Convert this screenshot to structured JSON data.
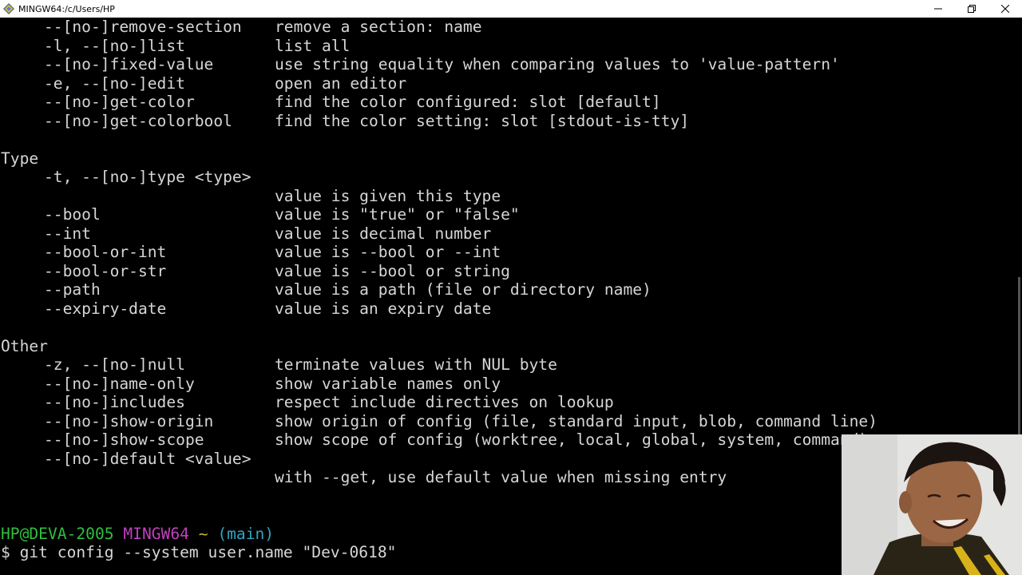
{
  "window": {
    "title": "MINGW64:/c/Users/HP",
    "icon": "git-bash-icon",
    "controls": [
      "minimize-icon",
      "maximize-icon",
      "close-icon"
    ]
  },
  "terminal": {
    "top_lines": [
      {
        "opt": "--[no-]remove-section",
        "desc": "remove a section: name"
      },
      {
        "opt": "-l, --[no-]list",
        "desc": "list all"
      },
      {
        "opt": "--[no-]fixed-value",
        "desc": "use string equality when comparing values to 'value-pattern'"
      },
      {
        "opt": "-e, --[no-]edit",
        "desc": "open an editor"
      },
      {
        "opt": "--[no-]get-color",
        "desc": "find the color configured: slot [default]"
      },
      {
        "opt": "--[no-]get-colorbool",
        "desc": "find the color setting: slot [stdout-is-tty]"
      }
    ],
    "type_section": {
      "heading": "Type",
      "lines": [
        {
          "opt": "-t, --[no-]type <type>",
          "desc": ""
        },
        {
          "opt": "",
          "desc": "value is given this type"
        },
        {
          "opt": "--bool",
          "desc": "value is \"true\" or \"false\""
        },
        {
          "opt": "--int",
          "desc": "value is decimal number"
        },
        {
          "opt": "--bool-or-int",
          "desc": "value is --bool or --int"
        },
        {
          "opt": "--bool-or-str",
          "desc": "value is --bool or string"
        },
        {
          "opt": "--path",
          "desc": "value is a path (file or directory name)"
        },
        {
          "opt": "--expiry-date",
          "desc": "value is an expiry date"
        }
      ]
    },
    "other_section": {
      "heading": "Other",
      "lines": [
        {
          "opt": "-z, --[no-]null",
          "desc": "terminate values with NUL byte"
        },
        {
          "opt": "--[no-]name-only",
          "desc": "show variable names only"
        },
        {
          "opt": "--[no-]includes",
          "desc": "respect include directives on lookup"
        },
        {
          "opt": "--[no-]show-origin",
          "desc": "show origin of config (file, standard input, blob, command line)"
        },
        {
          "opt": "--[no-]show-scope",
          "desc": "show scope of config (worktree, local, global, system, command)"
        },
        {
          "opt": "--[no-]default <value>",
          "desc": ""
        },
        {
          "opt": "",
          "desc": "with --get, use default value when missing entry"
        }
      ]
    },
    "prompt": {
      "user_host": "HP@DEVA-2005",
      "system": "MINGW64",
      "dir": "~",
      "branch": "(main)",
      "symbol": "$",
      "command": "git config --system user.name \"Dev-0618\""
    },
    "colors": {
      "background": "#000000",
      "text": "#d6d6d6",
      "user_host": "#2fbf40",
      "system": "#bf40bf",
      "dir": "#c9b830",
      "branch": "#2ea5c0"
    }
  },
  "webcam": {
    "label": "webcam-overlay"
  }
}
